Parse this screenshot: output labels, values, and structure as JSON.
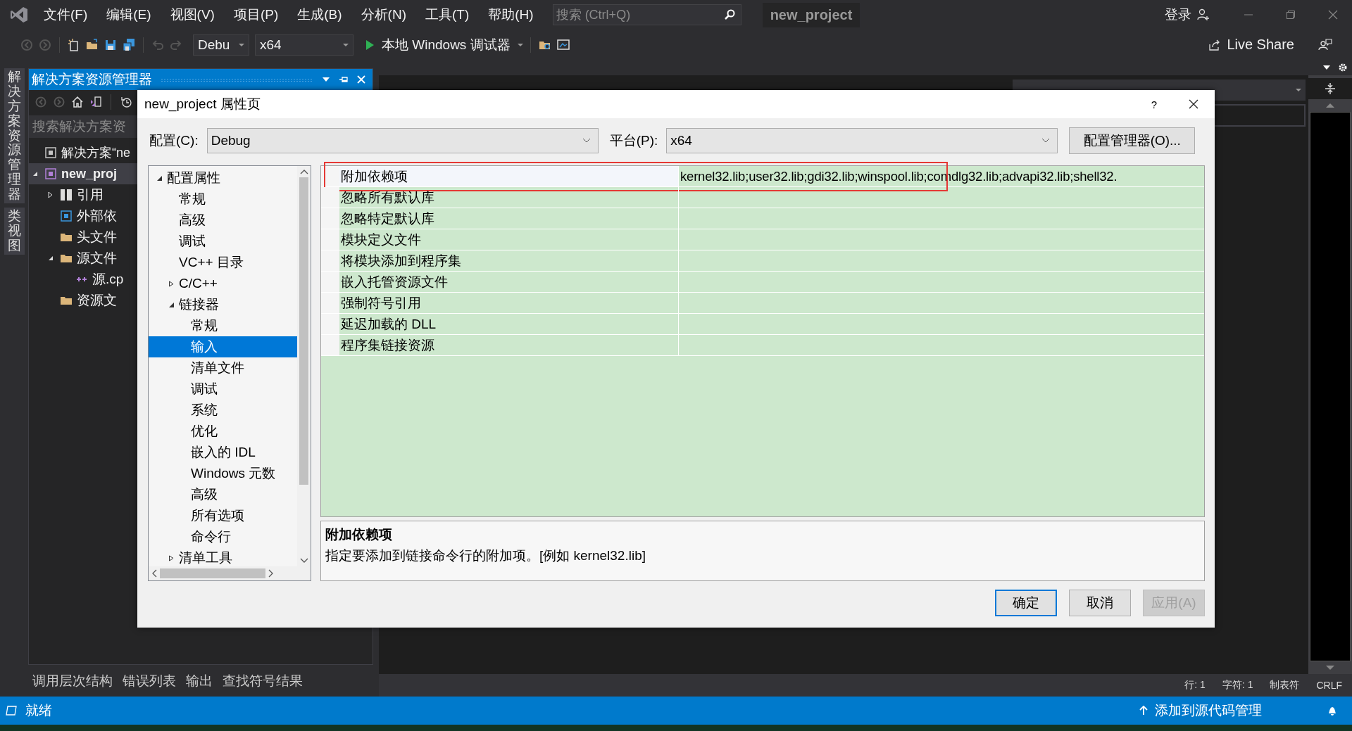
{
  "menu_bar": {
    "items": [
      "文件(F)",
      "编辑(E)",
      "视图(V)",
      "项目(P)",
      "生成(B)",
      "分析(N)",
      "工具(T)",
      "帮助(H)"
    ],
    "search": {
      "placeholder": "搜索 (Ctrl+Q)"
    },
    "project_name": "new_project",
    "sign_in": "登录"
  },
  "toolbar": {
    "configuration": "Debu",
    "platform": "x64",
    "debugger": "本地 Windows 调试器",
    "live_share": "Live Share"
  },
  "side_tabs": [
    "解决方案资源管理器",
    "类视图"
  ],
  "solution_explorer": {
    "title": "解决方案资源管理器",
    "search": {
      "placeholder": "搜索解决方案资"
    },
    "tree": [
      {
        "label": "解决方案“ne",
        "kind": "solution",
        "selected": false
      },
      {
        "label": "new_proj",
        "kind": "project",
        "selected": true,
        "expanded": true,
        "children": [
          {
            "label": "引用",
            "kind": "references",
            "selected": false,
            "expanded": false
          },
          {
            "label": "外部依",
            "kind": "external",
            "selected": false
          },
          {
            "label": "头文件",
            "kind": "folder",
            "selected": false
          },
          {
            "label": "源文件",
            "kind": "folder",
            "selected": false,
            "expanded": true,
            "children": [
              {
                "label": "源.cp",
                "kind": "source",
                "selected": false
              }
            ]
          },
          {
            "label": "资源文",
            "kind": "folder",
            "selected": false
          }
        ]
      }
    ]
  },
  "dialog": {
    "title": "new_project 属性页",
    "help": "?",
    "configuration": {
      "label": "配置(C):",
      "value": "Debug"
    },
    "platform": {
      "label": "平台(P):",
      "value": "x64"
    },
    "manager_button": "配置管理器(O)...",
    "tree": [
      {
        "label": "配置属性",
        "selected": false,
        "expanded": true,
        "children": [
          {
            "label": "常规",
            "selected": false
          },
          {
            "label": "高级",
            "selected": false
          },
          {
            "label": "调试",
            "selected": false
          },
          {
            "label": "VC++ 目录",
            "selected": false
          },
          {
            "label": "C/C++",
            "selected": false,
            "expanded": false
          },
          {
            "label": "链接器",
            "selected": false,
            "expanded": true,
            "children": [
              {
                "label": "常规",
                "selected": false
              },
              {
                "label": "输入",
                "selected": true
              },
              {
                "label": "清单文件",
                "selected": false
              },
              {
                "label": "调试",
                "selected": false
              },
              {
                "label": "系统",
                "selected": false
              },
              {
                "label": "优化",
                "selected": false
              },
              {
                "label": "嵌入的 IDL",
                "selected": false
              },
              {
                "label": "Windows 元数",
                "selected": false
              },
              {
                "label": "高级",
                "selected": false
              },
              {
                "label": "所有选项",
                "selected": false
              },
              {
                "label": "命令行",
                "selected": false
              }
            ]
          },
          {
            "label": "清单工具",
            "selected": false,
            "expanded": false
          }
        ]
      }
    ],
    "properties": [
      {
        "name": "附加依赖项",
        "value": "kernel32.lib;user32.lib;gdi32.lib;winspool.lib;comdlg32.lib;advapi32.lib;shell32.",
        "selected": true,
        "highlighted": true
      },
      {
        "name": "忽略所有默认库",
        "selected": false,
        "highlighted": false
      },
      {
        "name": "忽略特定默认库",
        "selected": false,
        "highlighted": false
      },
      {
        "name": "模块定义文件",
        "selected": false,
        "highlighted": false
      },
      {
        "name": "将模块添加到程序集",
        "selected": false,
        "highlighted": false
      },
      {
        "name": "嵌入托管资源文件",
        "selected": false,
        "highlighted": false
      },
      {
        "name": "强制符号引用",
        "selected": false,
        "highlighted": false
      },
      {
        "name": "延迟加载的 DLL",
        "selected": false,
        "highlighted": false
      },
      {
        "name": "程序集链接资源",
        "selected": false,
        "highlighted": false
      }
    ],
    "description": {
      "title": "附加依赖项",
      "text": "指定要添加到链接命令行的附加项。[例如 kernel32.lib]"
    },
    "buttons": [
      {
        "label": "确定",
        "default": true,
        "disabled": false
      },
      {
        "label": "取消",
        "default": false,
        "disabled": false
      },
      {
        "label": "应用(A)",
        "default": false,
        "disabled": true
      }
    ]
  },
  "editor": {
    "status": [
      "行: 1",
      "字符: 1",
      "制表符",
      "CRLF"
    ]
  },
  "bottom_tabs": [
    "调用层次结构",
    "错误列表",
    "输出",
    "查找符号结果"
  ],
  "status_bar": {
    "message": "就绪",
    "source_control": "添加到源代码管理"
  }
}
